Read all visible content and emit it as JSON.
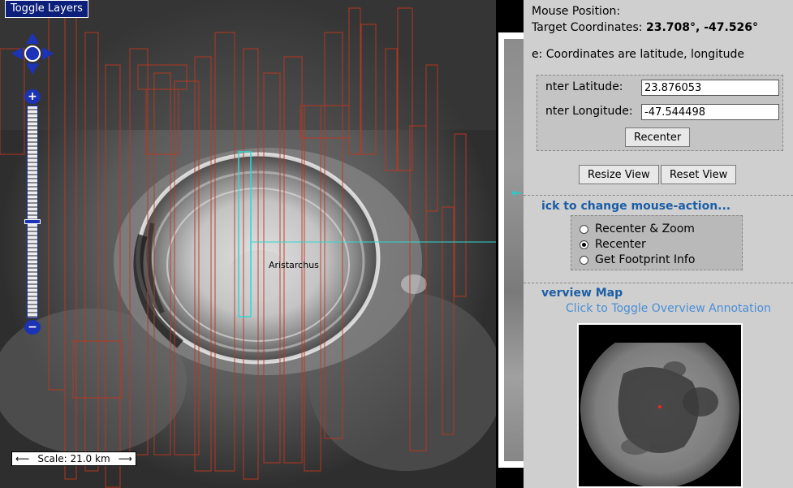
{
  "map": {
    "toggle_layers_label": "Toggle Layers",
    "feature_label": "Aristarchus",
    "scale": {
      "left_arrow": "⟵",
      "label": "Scale: 21.0 km",
      "right_arrow": "⟶"
    },
    "zoom": {
      "plus": "+",
      "minus": "−"
    }
  },
  "panel": {
    "mouse_position_label": "Mouse Position:",
    "target_label": "Target Coordinates:",
    "target_value": "23.708°, -47.526°",
    "note": "e: Coordinates are latitude, longitude",
    "center_latitude_label": "nter Latitude:",
    "center_latitude_value": "23.876053",
    "center_longitude_label": "nter Longitude:",
    "center_longitude_value": "-47.544498",
    "recenter_button": "Recenter",
    "resize_view_button": "Resize View",
    "reset_view_button": "Reset View",
    "mouse_action_title": "ick to change mouse-action...",
    "mouse_actions": [
      {
        "label": "Recenter & Zoom",
        "selected": false
      },
      {
        "label": "Recenter",
        "selected": true
      },
      {
        "label": "Get Footprint Info",
        "selected": false
      }
    ],
    "overview_title": "verview Map",
    "overview_toggle_link": "Click to Toggle Overview Annotation"
  },
  "colors": {
    "footprint": "#c0371f",
    "selected_footprint": "#33d6cf",
    "nav_blue": "#1c33b5",
    "panel_bg": "#cfcfcf",
    "section_title": "#1b5ea6",
    "link": "#4a8ed6"
  }
}
